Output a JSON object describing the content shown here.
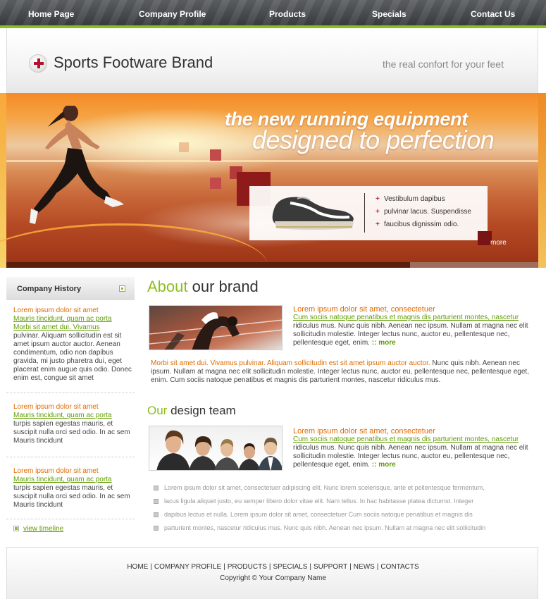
{
  "nav": {
    "items": [
      "Home Page",
      "Company Profile",
      "Products",
      "Specials",
      "Contact Us"
    ]
  },
  "header": {
    "brand": "Sports Footware Brand",
    "tagline": "the real confort for your feet",
    "icon": "red-cross-logo-icon"
  },
  "banner": {
    "headline1": "the new running equipment",
    "headline2": "designed to perfection",
    "features": [
      "Vestibulum dapibus",
      "pulvinar lacus. Suspendisse",
      "faucibus dignissim odio."
    ],
    "more": "more"
  },
  "sidebar": {
    "title": "Company History",
    "blocks": [
      {
        "title": "Lorem ipsum dolor sit amet",
        "links": [
          "Mauris tincidunt, quam ac porta",
          "Morbi sit amet dui. Vivamus"
        ],
        "text": "pulvinar. Aliquam sollicitudin est sit amet ipsum auctor auctor. Aenean condimentum, odio non dapibus gravida, mi justo pharetra dui, eget placerat enim augue quis odio. Donec enim est, congue sit amet"
      },
      {
        "title": "Lorem ipsum dolor sit amet",
        "links": [
          "Mauris tincidunt, quam ac porta"
        ],
        "text": "turpis sapien egestas mauris, et suscipit nulla orci sed odio. In ac sem Mauris tincidunt"
      },
      {
        "title": "Lorem ipsum dolor sit amet",
        "links": [
          "Mauris tincidunt, quam ac porta"
        ],
        "text": "turpis sapien egestas mauris, et suscipit nulla orci sed odio. In ac sem Mauris tincidunt"
      }
    ],
    "timeline_link": "view timeline"
  },
  "about": {
    "heading_a": "About",
    "heading_b": " our brand",
    "title": "Lorem ipsum dolor sit amet, consectetuer",
    "link": "Cum sociis natoque penatibus et magnis dis parturient montes, nascetur",
    "text": "ridiculus mus. Nunc quis nibh. Aenean nec ipsum. Nullam at magna nec elit sollicitudin molestie. Integer lectus nunc, auctor eu, pellentesque nec, pellentesque eget, enim.",
    "more": ":: more",
    "full_lead": "Morbi sit amet dui. Vivamus pulvinar. Aliquam sollicitudin est sit amet ipsum auctor auctor.",
    "full_text": " Nunc quis nibh. Aenean nec ipsum. Nullam at magna nec elit sollicitudin molestie. Integer lectus nunc, auctor eu, pellentesque nec, pellentesque eget, enim. Cum sociis natoque penatibus et magnis dis parturient montes, nascetur ridiculus mus."
  },
  "team": {
    "heading_a": "Our",
    "heading_b": " design team",
    "title": "Lorem ipsum dolor sit amet, consectetuer",
    "link": "Cum sociis natoque penatibus et magnis dis parturient montes, nascetur",
    "text": "ridiculus mus. Nunc quis nibh. Aenean nec ipsum. Nullam at magna nec elit sollicitudin molestie. Integer lectus nunc, auctor eu, pellentesque nec, pellentesque eget, enim.",
    "more": ":: more",
    "bullets": [
      "Lorem ipsum dolor sit amet, consectetuer adipiscing elit. Nunc lorem scelerisque, ante et pellentesque fermentum,",
      "lacus ligula aliquet justo, eu semper libero dolor vitae elit. Nam tellus. In hac habitasse platea dictumst. Integer",
      "dapibus lectus et nulla. Lorem ipsum dolor sit amet, consectetuer Cum sociis natoque penatibus et magnis dis",
      "parturient montes, nascetur ridiculus mus. Nunc quis nibh. Aenean nec ipsum. Nullam at magna nec elit sollicitudin"
    ]
  },
  "footer": {
    "links": [
      "HOME",
      "COMPANY PROFILE",
      "PRODUCTS",
      "SPECIALS",
      "SUPPORT",
      "NEWS",
      "CONTACTS"
    ],
    "separator": "|",
    "copyright": "Copyright © Your Company Name"
  },
  "colors": {
    "accent_green": "#8cbd1e",
    "accent_orange": "#e06a00",
    "brand_red": "#b3122f",
    "nav_dark": "#3b3f42"
  }
}
